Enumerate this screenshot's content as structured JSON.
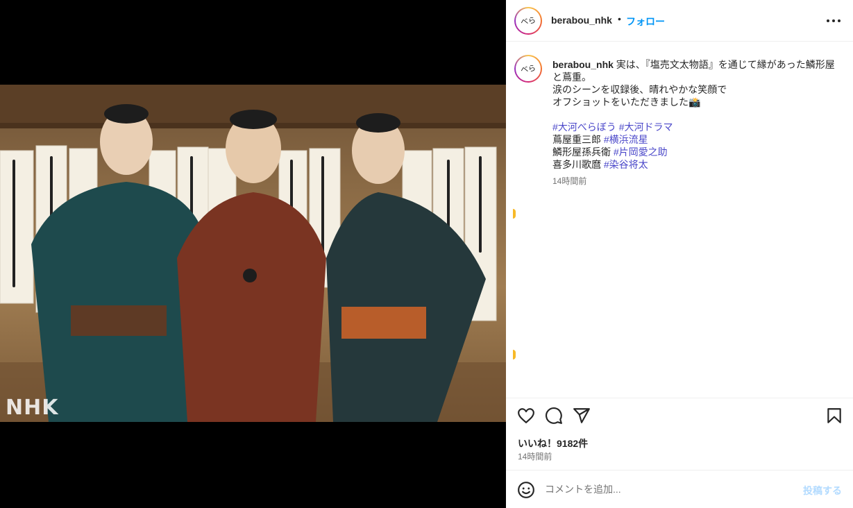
{
  "post": {
    "account": "berabou_nhk",
    "follow_label": "フォロー",
    "watermark": "NHK",
    "avatar_text": "べら"
  },
  "caption": {
    "lines": [
      "実は、『塩売文太物語』を通じて縁があった鱗形屋",
      "と蔦重。",
      "涙のシーンを収録後、晴れやかな笑顔で",
      "オフショットをいただきました📸",
      "",
      {
        "tags": [
          "#大河べらぼう",
          "#大河ドラマ"
        ]
      },
      {
        "text": "蔦屋重三郎 ",
        "tag": "#横浜流星"
      },
      {
        "text": "鱗形屋孫兵衛 ",
        "tag": "#片岡愛之助"
      },
      {
        "text": "喜多川歌麿 ",
        "tag": "#染谷将太"
      }
    ],
    "time": "14時間前"
  },
  "stats": {
    "likes": "いいね！9182件",
    "time": "14時間前"
  },
  "comment": {
    "placeholder": "コメントを追加...",
    "post_label": "投稿する"
  },
  "colors": {
    "accent_blue": "#0095f6",
    "hashtag": "#4a47c9",
    "post_disabled": "#b3dbff"
  },
  "icons": [
    "more-icon",
    "heart-icon",
    "comment-icon",
    "share-icon",
    "bookmark-icon",
    "emoji-icon"
  ]
}
